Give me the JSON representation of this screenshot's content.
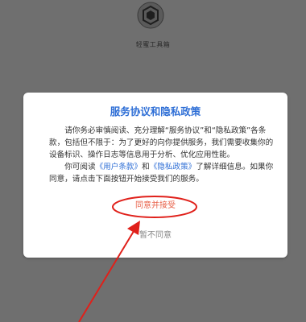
{
  "app": {
    "name": "轻蜜工具箱",
    "icon": "hexagon-logo-icon"
  },
  "dialog": {
    "title": "服务协议和隐私政策",
    "body": {
      "p1": "请你务必审慎阅读、充分理解“服务协议”和“隐私政策”各条款，包括但不限于：为了更好的向你提供服务，我们需要收集你的设备标识、操作日志等信息用于分析、优化应用性能。",
      "p2_prefix": "你可阅读",
      "user_terms_link": "《用户条款》",
      "and": "和",
      "privacy_link": "《隐私政策》",
      "p2_suffix": "了解详细信息。如果你同意，请点击下面按钮开始接受我们的服务。"
    },
    "agree_label": "同意并接受",
    "disagree_label": "暂不同意"
  },
  "colors": {
    "accent": "#2f6fd6",
    "agree": "#e8624a",
    "annotation": "#e0201a",
    "overlay": "#6f6f6f"
  }
}
